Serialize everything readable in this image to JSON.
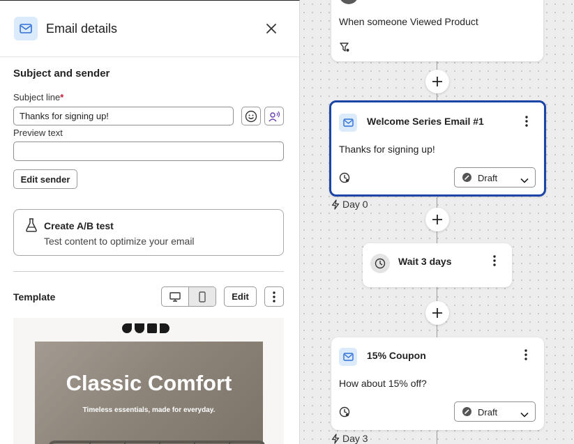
{
  "panel": {
    "title": "Email details",
    "section_title": "Subject and sender",
    "subject_label": "Subject line",
    "required_mark": "*",
    "subject_value": "Thanks for signing up!",
    "preview_label": "Preview text",
    "preview_value": "",
    "edit_sender": "Edit sender",
    "ab_title": "Create A/B test",
    "ab_subtitle": "Test content to optimize your email",
    "template_label": "Template",
    "edit_button": "Edit",
    "hero_title": "Classic Comfort",
    "hero_subtitle": "Timeless essentials, made for everyday."
  },
  "flow": {
    "trigger_text": "When someone Viewed Product",
    "email1_title": "Welcome Series Email #1",
    "email1_body": "Thanks for signing up!",
    "email1_status": "Draft",
    "day0": "Day 0",
    "wait_title": "Wait 3 days",
    "email2_title": "15% Coupon",
    "email2_body": "How about 15% off?",
    "email2_status": "Draft",
    "day3": "Day 3"
  },
  "colors": {
    "accent": "#1a44a8",
    "icon_bg": "#dcebfb",
    "required": "#d1152f"
  }
}
